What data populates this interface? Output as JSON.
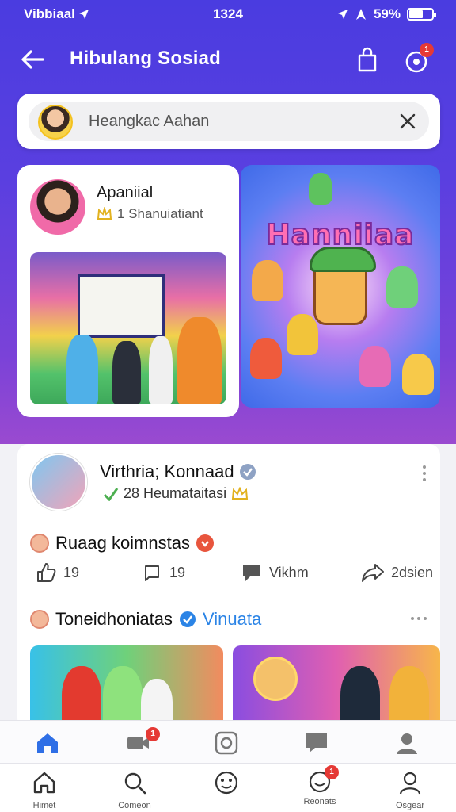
{
  "status_bar": {
    "carrier": "Vibbiaal",
    "time": "1324",
    "battery": "59%",
    "battery_level": 0.59
  },
  "header": {
    "title": "Hibulang Sosiad",
    "notification_count": "1"
  },
  "search": {
    "placeholder": "Heangkac Aahan"
  },
  "featured": {
    "profile_name": "Apaniial",
    "profile_meta": "1 Shanuiatiant",
    "art_title": "Hanniiaa"
  },
  "post": {
    "author": "Virthria; Konnaad",
    "meta": "28 Heumataitasi",
    "caption": "Ruaag koimnstas",
    "actions": [
      {
        "icon": "like-icon",
        "label": "19"
      },
      {
        "icon": "repost-icon",
        "label": "19"
      },
      {
        "icon": "comment-icon",
        "label": "Vikhm"
      },
      {
        "icon": "share-icon",
        "label": "2dsien"
      }
    ],
    "subheader": "Toneidhoniatas",
    "subheader_tag": "Vinuata"
  },
  "tabbar_upper": [
    {
      "icon": "home-icon",
      "badge": ""
    },
    {
      "icon": "video-icon",
      "badge": "1"
    },
    {
      "icon": "camera-icon",
      "badge": ""
    },
    {
      "icon": "message-icon",
      "badge": ""
    },
    {
      "icon": "profile-icon",
      "badge": ""
    }
  ],
  "tabbar_lower": [
    {
      "icon": "home-icon",
      "label": "Himet",
      "badge": ""
    },
    {
      "icon": "search-icon",
      "label": "Comeon",
      "badge": ""
    },
    {
      "icon": "emoji-icon",
      "label": "",
      "badge": ""
    },
    {
      "icon": "chat-icon",
      "label": "Reonats",
      "badge": "1"
    },
    {
      "icon": "profile-icon",
      "label": "Osgear",
      "badge": ""
    }
  ],
  "colors": {
    "brand": "#4a3ce0",
    "accent": "#2b84e6",
    "badge": "#e53935"
  }
}
